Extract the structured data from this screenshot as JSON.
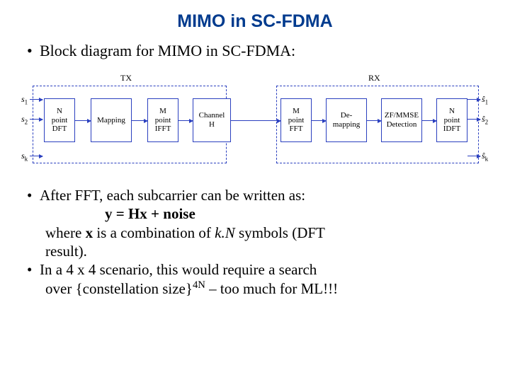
{
  "title": "MIMO in SC-FDMA",
  "bullet_intro": "Block diagram for MIMO in SC-FDMA:",
  "diagram": {
    "tx_label": "TX",
    "rx_label": "RX",
    "signals_in": {
      "s1": "s",
      "s1_sub": "1",
      "s2": "s",
      "s2_sub": "2",
      "sk": "s",
      "sk_sub": "k"
    },
    "signals_out": {
      "s1": "ŝ",
      "s1_sub": "1",
      "s2": "ŝ",
      "s2_sub": "2",
      "sk": "ŝ",
      "sk_sub": "k"
    },
    "blocks": {
      "dft": "N\npoint\nDFT",
      "mapping": "Mapping",
      "ifft": "M\npoint\nIFFT",
      "channel": "Channel\nH",
      "fft": "M\npoint\nFFT",
      "demapping": "De-\nmapping",
      "detection": "ZF/MMSE\nDetection",
      "idft": "N\npoint\nIDFT"
    }
  },
  "body": {
    "b1_l1": "After FFT, each subcarrier can be written as:",
    "b1_eq": "y = Hx + noise",
    "b1_l2a": "where ",
    "b1_l2b": "x",
    "b1_l2c": " is a combination of ",
    "b1_l2d": "k.N",
    "b1_l2e": " symbols (DFT",
    "b1_l3": "result).",
    "b2_l1": "In a 4 x 4 scenario, this would require a search",
    "b2_l2a": "over {constellation size}",
    "b2_l2b": "4N",
    "b2_l2c": " – too much for ML!!!"
  }
}
